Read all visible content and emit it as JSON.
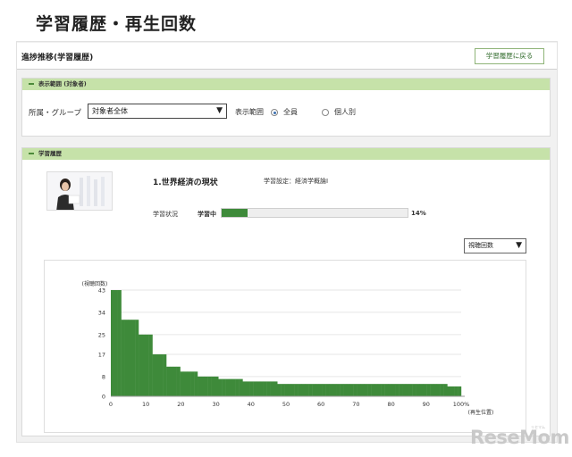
{
  "caption": "学習履歴・再生回数",
  "header": {
    "title": "進捗推移(学習履歴)",
    "back_label": "学習履歴に戻る"
  },
  "filter_panel": {
    "heading": "表示範囲 (対象者)",
    "group_label": "所属・グループ",
    "group_value": "対象者全体",
    "range_label": "表示範囲",
    "options": [
      {
        "label": "全員",
        "selected": true
      },
      {
        "label": "個人別",
        "selected": false
      }
    ]
  },
  "history_panel": {
    "heading": "学習履歴",
    "course_title": "1.世界経済の現状",
    "course_setting": "学習設定：経済学概論Ⅰ",
    "status_label": "学習状況",
    "status_value": "学習中",
    "progress": 0.14,
    "progress_text": "14%",
    "metric_select": "視聴回数"
  },
  "colors": {
    "accent": "#3e8a3a",
    "panel_header": "#c6e2a9",
    "bar": "#3e8a3a"
  },
  "chart_data": {
    "type": "bar",
    "ylabel": "(視聴回数)",
    "xlabel": "(再生位置)",
    "y_ticks": [
      "0",
      "8",
      "17",
      "25",
      "34",
      "43"
    ],
    "x_ticks": [
      "0",
      "10",
      "20",
      "30",
      "40",
      "50",
      "60",
      "70",
      "80",
      "90",
      "100%"
    ],
    "ylim": [
      0,
      43
    ],
    "xlim": [
      0,
      100
    ],
    "values": [
      43,
      43,
      43,
      31,
      31,
      31,
      31,
      31,
      25,
      25,
      25,
      25,
      17,
      17,
      17,
      17,
      12,
      12,
      12,
      12,
      10,
      10,
      10,
      10,
      10,
      8,
      8,
      8,
      8,
      8,
      8,
      7,
      7,
      7,
      7,
      7,
      7,
      7,
      6,
      6,
      6,
      6,
      6,
      6,
      6,
      6,
      6,
      6,
      5,
      5,
      5,
      5,
      5,
      5,
      5,
      5,
      5,
      5,
      5,
      5,
      5,
      5,
      5,
      5,
      5,
      5,
      5,
      5,
      5,
      5,
      5,
      5,
      5,
      5,
      5,
      5,
      5,
      5,
      5,
      5,
      5,
      5,
      5,
      5,
      5,
      5,
      5,
      5,
      5,
      5,
      5,
      5,
      5,
      5,
      5,
      5,
      5,
      4,
      4,
      4,
      4
    ]
  },
  "logo": {
    "text": "ReseMom",
    "sub": "リセマム"
  }
}
